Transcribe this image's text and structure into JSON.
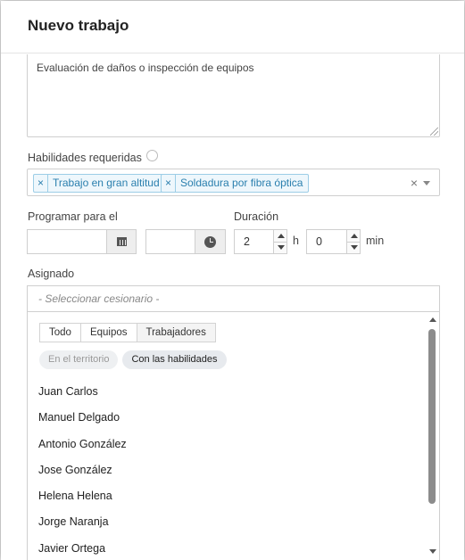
{
  "dialog": {
    "title": "Nuevo trabajo"
  },
  "description": {
    "value": "Evaluación de daños o inspección de equipos"
  },
  "skills": {
    "label": "Habilidades requeridas",
    "tags": [
      "Trabajo en gran altitud",
      "Soldadura por fibra óptica"
    ],
    "remove_symbol": "×",
    "clear_symbol": "×"
  },
  "schedule": {
    "label": "Programar para el",
    "date_value": "",
    "time_value": ""
  },
  "duration": {
    "label": "Duración",
    "hours": "2",
    "hours_unit": "h",
    "minutes": "0",
    "minutes_unit": "min"
  },
  "assignee": {
    "label": "Asignado",
    "placeholder": "- Seleccionar cesionario -",
    "tabs": [
      "Todo",
      "Equipos",
      "Trabajadores"
    ],
    "active_tab": "Trabajadores",
    "filters": [
      "En el territorio",
      "Con las habilidades"
    ],
    "people": [
      "Juan Carlos",
      "Manuel Delgado",
      "Antonio González",
      "Jose González",
      "Helena Helena",
      "Jorge Naranja",
      "Javier Ortega"
    ]
  },
  "icons": {
    "date": "calendar-icon",
    "time": "clock-icon",
    "info": "info-icon"
  }
}
